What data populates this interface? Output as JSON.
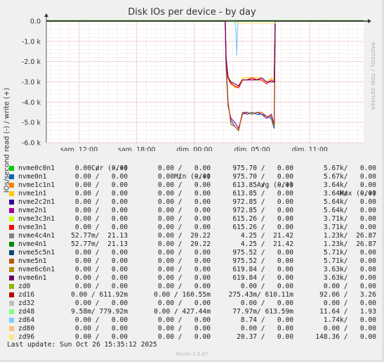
{
  "title": "Disk IOs per device - by day",
  "side_label": "RRDTOOL / TOBI OETIKER",
  "footer": "Munin 2.0.67",
  "last_update": "Last update: Sun Oct 26 15:35:12 2025",
  "legend_header": {
    "cur": "Cur (-/+)",
    "min": "Min (-/+)",
    "avg": "Avg (-/+)",
    "max": "Max (-/+)"
  },
  "legend": [
    {
      "name": "nvme0c0n1",
      "color": "#00cc00",
      "cur": "0.00 /   0.00",
      "min": "0.00 /   0.00",
      "avg": "975.70 /   0.00",
      "max": "5.67k/   0.00"
    },
    {
      "name": "nvme0n1",
      "color": "#0066b3",
      "cur": "0.00 /   0.00",
      "min": "0.00 /   0.00",
      "avg": "975.70 /   0.00",
      "max": "5.67k/   0.00"
    },
    {
      "name": "nvme1c1n1",
      "color": "#ff8000",
      "cur": "0.00 /   0.00",
      "min": "0.00 /   0.00",
      "avg": "613.85 /   0.00",
      "max": "3.64k/   0.00"
    },
    {
      "name": "nvme1n1",
      "color": "#ffcc00",
      "cur": "0.00 /   0.00",
      "min": "0.00 /   0.00",
      "avg": "613.85 /   0.00",
      "max": "3.64k/   0.00"
    },
    {
      "name": "nvme2c2n1",
      "color": "#330099",
      "cur": "0.00 /   0.00",
      "min": "0.00 /   0.00",
      "avg": "972.85 /   0.00",
      "max": "5.64k/   0.00"
    },
    {
      "name": "nvme2n1",
      "color": "#990099",
      "cur": "0.00 /   0.00",
      "min": "0.00 /   0.00",
      "avg": "972.85 /   0.00",
      "max": "5.64k/   0.00"
    },
    {
      "name": "nvme3c3n1",
      "color": "#ccff00",
      "cur": "0.00 /   0.00",
      "min": "0.00 /   0.00",
      "avg": "615.26 /   0.00",
      "max": "3.71k/   0.00"
    },
    {
      "name": "nvme3n1",
      "color": "#ff0000",
      "cur": "0.00 /   0.00",
      "min": "0.00 /   0.00",
      "avg": "615.26 /   0.00",
      "max": "3.71k/   0.00"
    },
    {
      "name": "nvme4c4n1",
      "color": "#808080",
      "cur": "52.77m/  21.13",
      "min": "0.00 /  20.22",
      "avg": "4.25 /  21.42",
      "max": "1.23k/  26.87"
    },
    {
      "name": "nvme4n1",
      "color": "#008f00",
      "cur": "52.77m/  21.13",
      "min": "0.00 /  20.22",
      "avg": "4.25 /  21.42",
      "max": "1.23k/  26.87"
    },
    {
      "name": "nvme5c5n1",
      "color": "#00487d",
      "cur": "0.00 /   0.00",
      "min": "0.00 /   0.00",
      "avg": "975.52 /   0.00",
      "max": "5.71k/   0.00"
    },
    {
      "name": "nvme5n1",
      "color": "#b35a00",
      "cur": "0.00 /   0.00",
      "min": "0.00 /   0.00",
      "avg": "975.52 /   0.00",
      "max": "5.71k/   0.00"
    },
    {
      "name": "nvme6c6n1",
      "color": "#b38f00",
      "cur": "0.00 /   0.00",
      "min": "0.00 /   0.00",
      "avg": "619.84 /   0.00",
      "max": "3.63k/   0.00"
    },
    {
      "name": "nvme6n1",
      "color": "#6b006b",
      "cur": "0.00 /   0.00",
      "min": "0.00 /   0.00",
      "avg": "619.84 /   0.00",
      "max": "3.63k/   0.00"
    },
    {
      "name": "zd0",
      "color": "#8fb300",
      "cur": "0.00 /   0.00",
      "min": "0.00 /   0.00",
      "avg": "0.00 /   0.00",
      "max": "0.00 /   0.00"
    },
    {
      "name": "zd16",
      "color": "#b30000",
      "cur": "0.00 / 611.92m",
      "min": "0.00 / 160.55m",
      "avg": "275.43m/ 610.11m",
      "max": "92.06 /   3.26"
    },
    {
      "name": "zd32",
      "color": "#bebebe",
      "cur": "0.00 /   0.00",
      "min": "0.00 /   0.00",
      "avg": "0.00 /   0.00",
      "max": "0.00 /   0.00"
    },
    {
      "name": "zd48",
      "color": "#80ff80",
      "cur": "9.58m/ 779.92m",
      "min": "0.00 / 427.44m",
      "avg": "77.97m/ 613.59m",
      "max": "11.64 /   1.93"
    },
    {
      "name": "zd64",
      "color": "#80c9ff",
      "cur": "0.00 /   0.00",
      "min": "0.00 /   0.00",
      "avg": "8.74 /   0.00",
      "max": "1.74k/   0.00"
    },
    {
      "name": "zd80",
      "color": "#ffc080",
      "cur": "0.00 /   0.00",
      "min": "0.00 /   0.00",
      "avg": "0.00 /   0.00",
      "max": "0.00 /   0.00"
    },
    {
      "name": "zd96",
      "color": "#ffe680",
      "cur": "0.00 /   0.00",
      "min": "0.00 /   0.00",
      "avg": "20.37 /   0.00",
      "max": "148.36 /   0.00"
    }
  ],
  "chart_data": {
    "type": "line",
    "title": "Disk IOs per device - by day",
    "ylabel": "IOs/second read (-) / write (+)",
    "ylim": [
      -6.0,
      0.0
    ],
    "y_ticks": [
      "0.0",
      "-1.0 k",
      "-2.0 k",
      "-3.0 k",
      "-4.0 k",
      "-5.0 k",
      "-6.0 k"
    ],
    "y_tick_values": [
      0,
      -1,
      -2,
      -3,
      -4,
      -5,
      -6
    ],
    "x_ticks": [
      "sam. 12:00",
      "sam. 18:00",
      "dim. 00:00",
      "dim. 05:00",
      "dim. 11:00"
    ],
    "x_tick_hours": [
      12,
      18,
      24,
      30,
      36
    ],
    "x_range_hours": [
      8.6,
      41.6
    ],
    "grid": true,
    "series": [
      {
        "name": "nvme0n1",
        "color": "#0066b3",
        "x": [
          8.6,
          27.2,
          27.3,
          27.5,
          27.8,
          28.2,
          28.6,
          29.0,
          29.5,
          30.0,
          30.5,
          31.0,
          31.5,
          32.0,
          32.3,
          32.4,
          32.6,
          41.6
        ],
        "y": [
          0,
          0,
          -2.3,
          -4.1,
          -4.9,
          -5.2,
          -5.4,
          -4.5,
          -4.6,
          -4.5,
          -4.6,
          -4.6,
          -4.7,
          -4.8,
          -5.3,
          0,
          0,
          0
        ]
      },
      {
        "name": "nvme2n1",
        "color": "#990099",
        "x": [
          8.6,
          27.2,
          27.3,
          27.5,
          27.8,
          28.2,
          28.6,
          29.0,
          29.5,
          30.0,
          30.5,
          31.0,
          31.5,
          32.0,
          32.3,
          32.4,
          32.6,
          41.6
        ],
        "y": [
          0,
          0,
          -2.2,
          -4.2,
          -4.8,
          -5.0,
          -5.3,
          -4.6,
          -4.5,
          -4.6,
          -4.5,
          -4.6,
          -4.8,
          -4.6,
          -5.1,
          0,
          0,
          0
        ]
      },
      {
        "name": "nvme5n1",
        "color": "#b35a00",
        "x": [
          8.6,
          27.2,
          27.3,
          27.5,
          27.8,
          28.2,
          28.6,
          29.0,
          29.5,
          30.0,
          30.5,
          31.0,
          31.5,
          32.0,
          32.3,
          32.4,
          32.6,
          41.6
        ],
        "y": [
          0,
          0,
          -2.0,
          -4.0,
          -5.1,
          -5.2,
          -5.4,
          -4.5,
          -4.5,
          -4.6,
          -4.5,
          -4.5,
          -4.7,
          -4.7,
          -5.2,
          0,
          0,
          0
        ]
      },
      {
        "name": "nvme1n1",
        "color": "#ffcc00",
        "x": [
          8.6,
          27.2,
          27.3,
          27.5,
          27.8,
          28.2,
          28.6,
          29.0,
          29.5,
          30.0,
          30.5,
          31.0,
          31.5,
          32.0,
          32.3,
          32.4,
          32.6,
          41.6
        ],
        "y": [
          0,
          0,
          -1.9,
          -2.7,
          -3.0,
          -3.3,
          -3.2,
          -2.8,
          -2.8,
          -2.8,
          -2.8,
          -2.8,
          -3.0,
          -2.8,
          -2.9,
          0,
          0,
          0
        ]
      },
      {
        "name": "nvme3n1",
        "color": "#ff0000",
        "x": [
          8.6,
          27.2,
          27.3,
          27.5,
          27.8,
          28.2,
          28.6,
          29.0,
          29.5,
          30.0,
          30.5,
          31.0,
          31.5,
          32.0,
          32.3,
          32.4,
          32.6,
          41.6
        ],
        "y": [
          0,
          0,
          -1.8,
          -2.8,
          -3.1,
          -3.2,
          -3.3,
          -2.9,
          -2.9,
          -2.8,
          -2.9,
          -2.9,
          -3.1,
          -2.9,
          -3.0,
          0,
          0,
          0
        ]
      },
      {
        "name": "nvme6n1",
        "color": "#6b006b",
        "x": [
          8.6,
          27.2,
          27.3,
          27.5,
          27.8,
          28.2,
          28.6,
          29.0,
          29.5,
          30.0,
          30.5,
          31.0,
          31.5,
          32.0,
          32.3,
          32.4,
          32.6,
          41.6
        ],
        "y": [
          0,
          0,
          -1.9,
          -2.8,
          -3.0,
          -3.1,
          -3.2,
          -2.9,
          -2.9,
          -2.9,
          -2.9,
          -2.8,
          -3.0,
          -3.0,
          -3.0,
          0,
          0,
          0
        ]
      },
      {
        "name": "zd64",
        "color": "#80c9ff",
        "x": [
          8.6,
          28.2,
          28.3,
          28.4,
          28.5,
          28.6,
          41.6
        ],
        "y": [
          0,
          0,
          -0.3,
          -1.7,
          -0.2,
          0,
          0
        ]
      },
      {
        "name": "nvme4n1",
        "color": "#008f00",
        "x": [
          8.6,
          41.6
        ],
        "y": [
          0.02,
          0.02
        ]
      },
      {
        "name": "zd96",
        "color": "#ffe680",
        "x": [
          8.6,
          28.3,
          28.4,
          29.0,
          32.4,
          32.5,
          41.6
        ],
        "y": [
          0,
          0,
          -0.1,
          -0.1,
          -0.1,
          0,
          0
        ]
      }
    ]
  }
}
